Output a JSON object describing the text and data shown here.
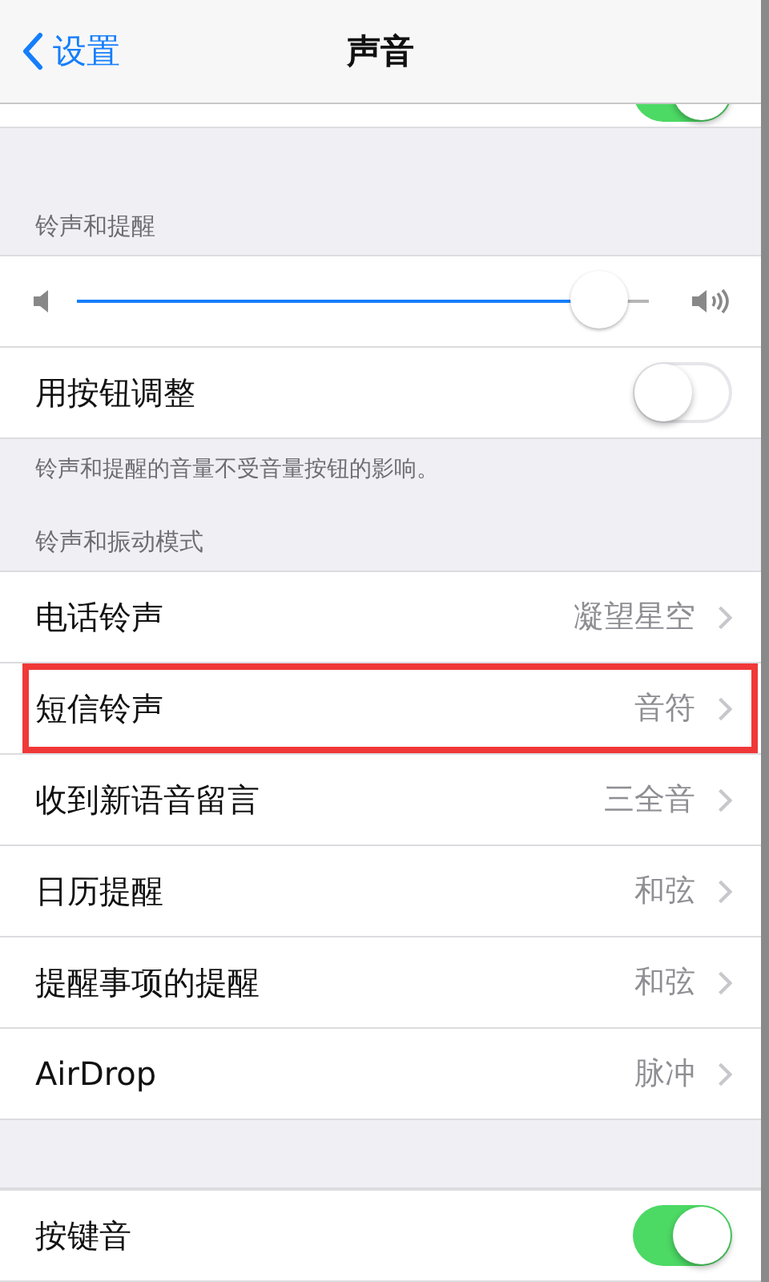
{
  "nav": {
    "back": "设置",
    "title": "声音"
  },
  "top_row": {
    "on": true
  },
  "ringer": {
    "header": "铃声和提醒",
    "volume": {
      "level": 0.96
    },
    "toggle": {
      "label": "用按钮调整",
      "on": false
    },
    "footer": "铃声和提醒的音量不受音量按钮的影响。"
  },
  "patterns": {
    "header": "铃声和振动模式",
    "rows": [
      {
        "label": "电话铃声",
        "value": "凝望星空",
        "highlighted": false
      },
      {
        "label": "短信铃声",
        "value": "音符",
        "highlighted": true
      },
      {
        "label": "收到新语音留言",
        "value": "三全音",
        "highlighted": false
      },
      {
        "label": "日历提醒",
        "value": "和弦",
        "highlighted": false
      },
      {
        "label": "提醒事项的提醒",
        "value": "和弦",
        "highlighted": false
      },
      {
        "label": "AirDrop",
        "value": "脉冲",
        "highlighted": false
      }
    ]
  },
  "keyboard": {
    "label": "按键音",
    "on": true
  }
}
